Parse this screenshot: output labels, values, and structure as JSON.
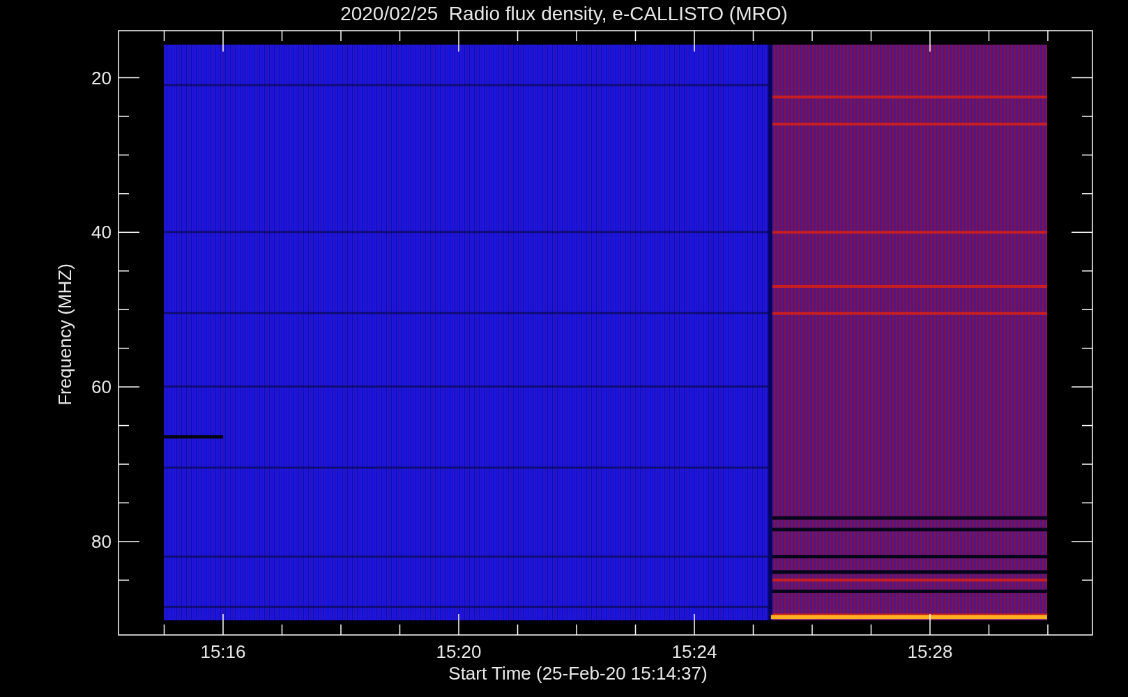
{
  "title": "2020/02/25  Radio flux density, e-CALLISTO (MRO)",
  "y_axis": {
    "label": "Frequency (MHZ)",
    "ticks": [
      "20",
      "40",
      "60",
      "80"
    ]
  },
  "x_axis": {
    "label": "Start Time (25-Feb-20 15:14:37)",
    "ticks": [
      "15:16",
      "15:20",
      "15:24",
      "15:28"
    ]
  }
}
